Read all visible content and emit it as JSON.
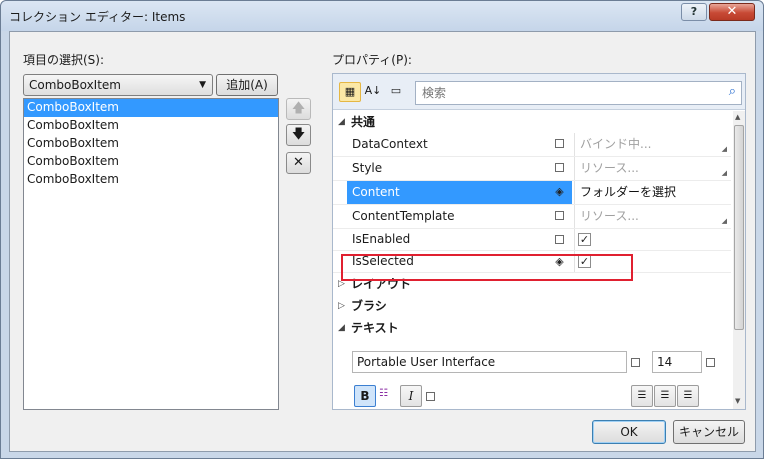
{
  "window": {
    "title": "コレクション エディター: Items",
    "help_label": "?",
    "close_label": "✕"
  },
  "left": {
    "label": "項目の選択(S):",
    "combo_value": "ComboBoxItem",
    "add_button": "追加(A)",
    "items": [
      "ComboBoxItem",
      "ComboBoxItem",
      "ComboBoxItem",
      "ComboBoxItem",
      "ComboBoxItem"
    ],
    "selected_index": 0
  },
  "reorder": {
    "up": "🡅",
    "down": "🡇",
    "remove": "✕"
  },
  "properties": {
    "label": "プロパティ(P):",
    "search_placeholder": "検索",
    "categories": {
      "common": "共通",
      "layout": "レイアウト",
      "brush": "ブラシ",
      "text": "テキスト"
    },
    "rows": [
      {
        "name": "DataContext",
        "value": "バインド中..."
      },
      {
        "name": "Style",
        "value": "リソース..."
      },
      {
        "name": "Content",
        "value": "フォルダーを選択"
      },
      {
        "name": "ContentTemplate",
        "value": "リソース..."
      },
      {
        "name": "IsEnabled",
        "value": "✓"
      },
      {
        "name": "IsSelected",
        "value": "✓"
      }
    ],
    "text_section": {
      "font_family": "Portable User Interface",
      "font_size": "14",
      "bold": "B",
      "italic": "I"
    }
  },
  "footer": {
    "ok": "OK",
    "cancel": "キャンセル"
  },
  "colors": {
    "selection": "#3399ff",
    "highlight_border": "#e02030"
  }
}
